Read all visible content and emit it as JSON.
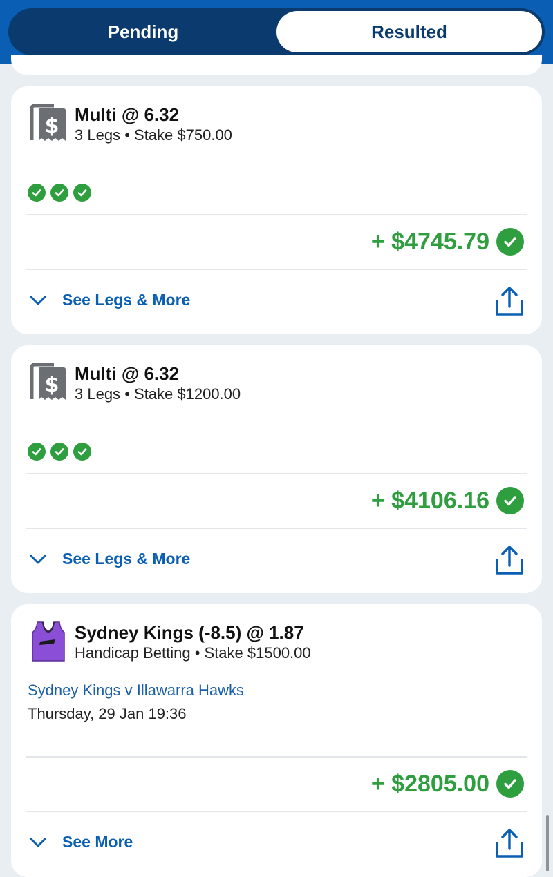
{
  "tabs": {
    "pending": "Pending",
    "resulted": "Resulted",
    "active": "Resulted"
  },
  "colors": {
    "brand_blue": "#0a5fb4",
    "dark_blue": "#0a3a6e",
    "win_green": "#2e9e3f",
    "link_blue": "#1a5fa8"
  },
  "bets": [
    {
      "icon": "multi-receipt-icon",
      "title": "Multi @ 6.32",
      "legs": "3 Legs",
      "separator": "•",
      "stake": "Stake $750.00",
      "leg_results": [
        "won",
        "won",
        "won"
      ],
      "payout": "+ $4745.79",
      "status": "won",
      "action": "See Legs & More"
    },
    {
      "icon": "multi-receipt-icon",
      "title": "Multi @ 6.32",
      "legs": "3 Legs",
      "separator": "•",
      "stake": "Stake $1200.00",
      "leg_results": [
        "won",
        "won",
        "won"
      ],
      "payout": "+ $4106.16",
      "status": "won",
      "action": "See Legs & More"
    },
    {
      "icon": "jersey-icon",
      "title": "Sydney Kings (-8.5) @ 1.87",
      "market": "Handicap Betting",
      "separator": "•",
      "stake": "Stake $1500.00",
      "match": "Sydney Kings v Illawarra Hawks",
      "date": "Thursday, 29 Jan 19:36",
      "payout": "+ $2805.00",
      "status": "won",
      "action": "See More",
      "jersey_color": "#8a4fd6"
    }
  ]
}
